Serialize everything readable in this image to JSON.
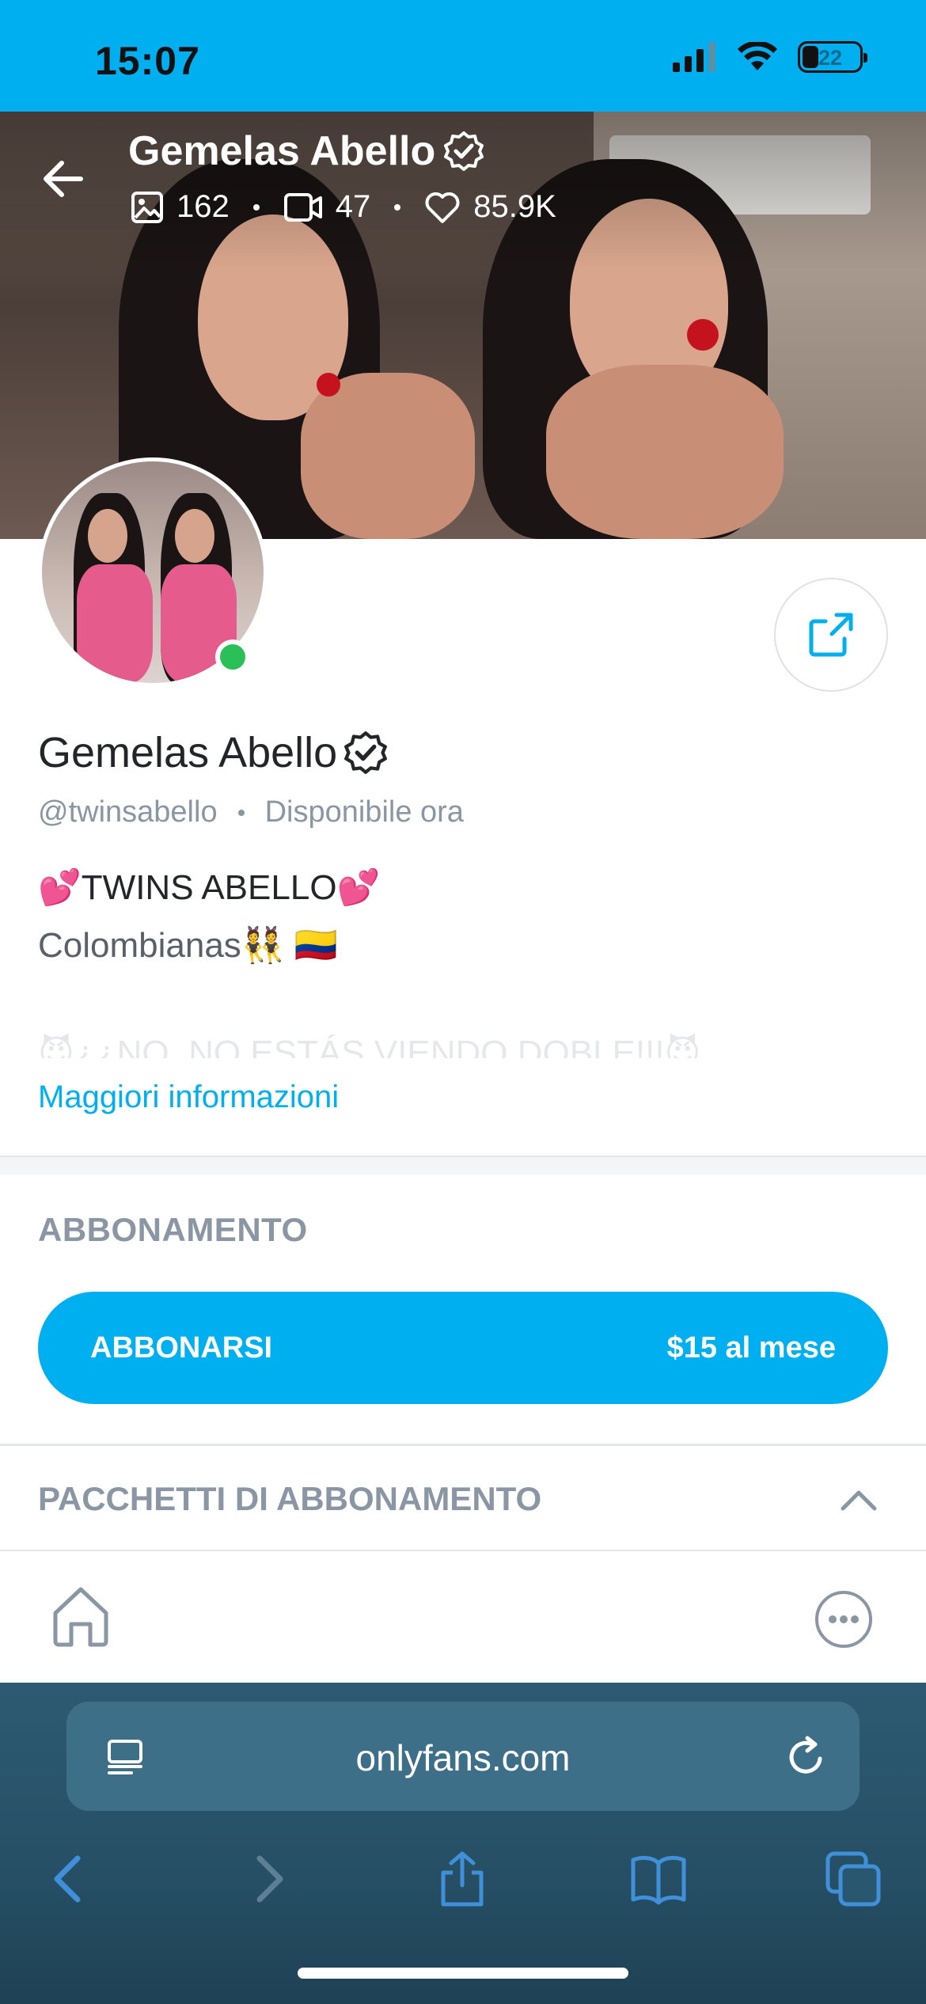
{
  "status_bar": {
    "time": "15:07",
    "battery": "22"
  },
  "cover": {
    "title": "Gemelas Abello",
    "stats": {
      "photos": "162",
      "videos": "47",
      "likes": "85.9K"
    }
  },
  "profile": {
    "name": "Gemelas Abello",
    "handle": "@twinsabello",
    "availability": "Disponibile ora",
    "bio_line1": "💕TWINS ABELLO💕",
    "bio_line2": "Colombianas👯 🇨🇴",
    "bio_faded": "😈¿¿NO, NO ESTÁS VIENDO DOBLE!!!😈",
    "more_info": "Maggiori informazioni"
  },
  "subscription": {
    "heading": "ABBONAMENTO",
    "button_label": "ABBONARSI",
    "price": "$15 al mese",
    "packages_heading": "PACCHETTI DI ABBONAMENTO"
  },
  "browser": {
    "url": "onlyfans.com"
  },
  "colors": {
    "accent": "#00aff0",
    "online": "#2bc057",
    "muted": "#8a96a3"
  },
  "icons": [
    "back-arrow-icon",
    "verified-icon",
    "image-icon",
    "video-icon",
    "heart-icon",
    "share-icon",
    "chevron-up-icon",
    "home-icon",
    "more-icon",
    "reader-icon",
    "reload-icon",
    "safari-back-icon",
    "safari-forward-icon",
    "safari-share-icon",
    "bookmarks-icon",
    "tabs-icon"
  ]
}
